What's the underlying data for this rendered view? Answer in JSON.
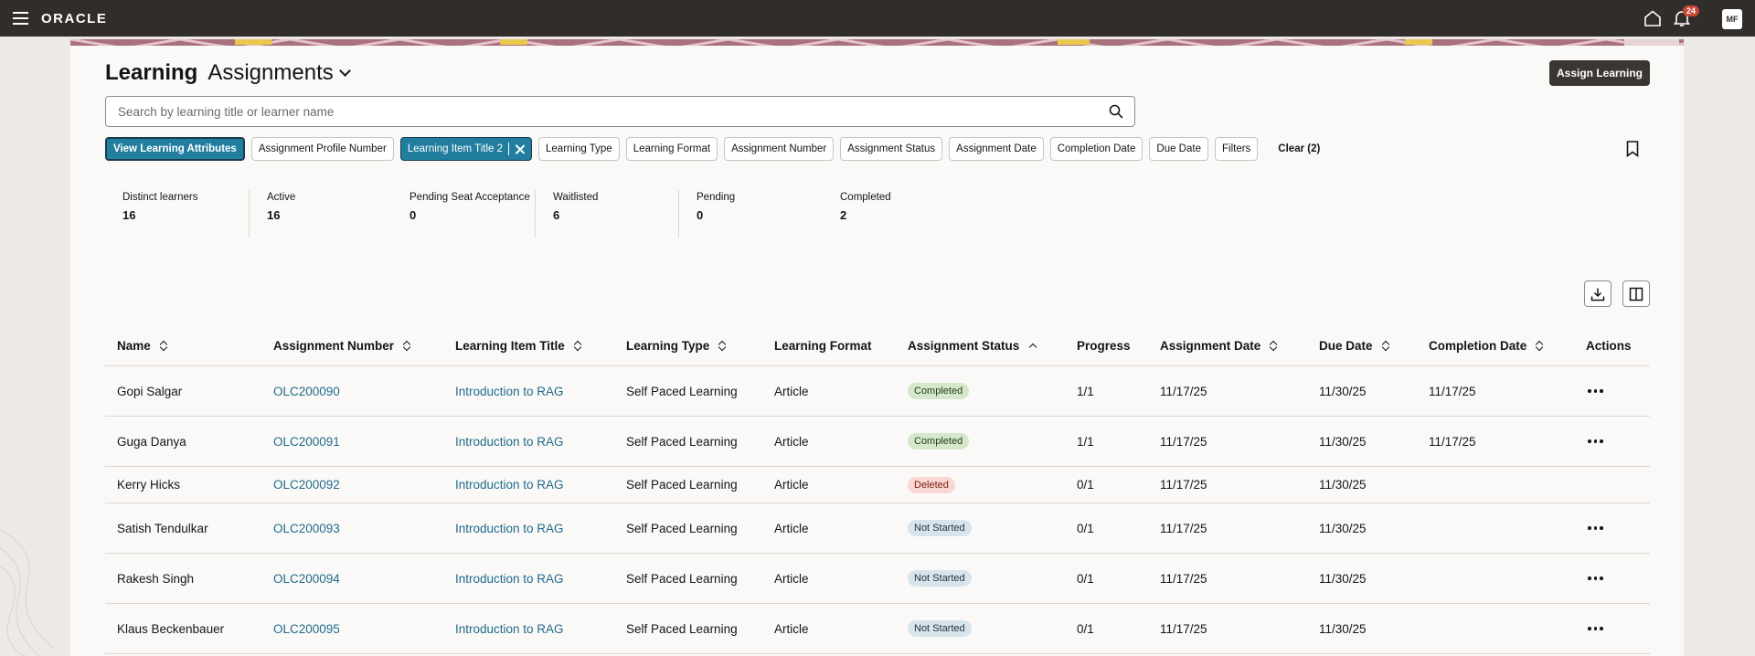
{
  "topbar": {
    "logo": "ORACLE",
    "notification_count": "24",
    "user_initials": "MF"
  },
  "page": {
    "title_main": "Learning",
    "title_sub": "Assignments",
    "assign_button": "Assign Learning",
    "search_placeholder": "Search by learning title or learner name"
  },
  "filters": {
    "primary": "View Learning Attributes",
    "chips": [
      "Assignment Profile Number",
      "Learning Item Title 2",
      "Learning Type",
      "Learning Format",
      "Assignment Number",
      "Assignment Status",
      "Assignment Date",
      "Completion Date",
      "Due Date",
      "Filters"
    ],
    "clear": "Clear (2)"
  },
  "metrics": [
    {
      "label": "Distinct learners",
      "value": "16"
    },
    {
      "label": "Active",
      "value": "16"
    },
    {
      "label": "Pending Seat Acceptance",
      "value": "0"
    },
    {
      "label": "Waitlisted",
      "value": "6"
    },
    {
      "label": "Pending",
      "value": "0"
    },
    {
      "label": "Completed",
      "value": "2"
    }
  ],
  "table": {
    "headers": [
      "Name",
      "Assignment Number",
      "Learning Item Title",
      "Learning Type",
      "Learning Format",
      "Assignment Status",
      "Progress",
      "Assignment Date",
      "Due Date",
      "Completion Date",
      "Actions"
    ],
    "rows": [
      {
        "name": "Gopi Salgar",
        "number": "OLC200090",
        "title": "Introduction to RAG",
        "type": "Self Paced Learning",
        "format": "Article",
        "status": "Completed",
        "progress": "1/1",
        "assigned": "11/17/25",
        "due": "11/30/25",
        "completed": "11/17/25"
      },
      {
        "name": "Guga Danya",
        "number": "OLC200091",
        "title": "Introduction to RAG",
        "type": "Self Paced Learning",
        "format": "Article",
        "status": "Completed",
        "progress": "1/1",
        "assigned": "11/17/25",
        "due": "11/30/25",
        "completed": "11/17/25"
      },
      {
        "name": "Kerry Hicks",
        "number": "OLC200092",
        "title": "Introduction to RAG",
        "type": "Self Paced Learning",
        "format": "Article",
        "status": "Deleted",
        "progress": "0/1",
        "assigned": "11/17/25",
        "due": "11/30/25",
        "completed": ""
      },
      {
        "name": "Satish Tendulkar",
        "number": "OLC200093",
        "title": "Introduction to RAG",
        "type": "Self Paced Learning",
        "format": "Article",
        "status": "Not Started",
        "progress": "0/1",
        "assigned": "11/17/25",
        "due": "11/30/25",
        "completed": ""
      },
      {
        "name": "Rakesh Singh",
        "number": "OLC200094",
        "title": "Introduction to RAG",
        "type": "Self Paced Learning",
        "format": "Article",
        "status": "Not Started",
        "progress": "0/1",
        "assigned": "11/17/25",
        "due": "11/30/25",
        "completed": ""
      },
      {
        "name": "Klaus Beckenbauer",
        "number": "OLC200095",
        "title": "Introduction to RAG",
        "type": "Self Paced Learning",
        "format": "Article",
        "status": "Not Started",
        "progress": "0/1",
        "assigned": "11/17/25",
        "due": "11/30/25",
        "completed": ""
      }
    ]
  }
}
